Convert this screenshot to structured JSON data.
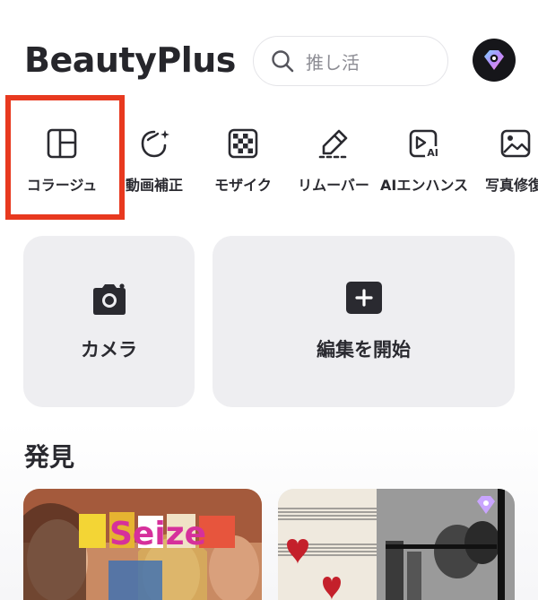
{
  "header": {
    "title": "BeautyPlus",
    "search_placeholder": "推し活"
  },
  "tools": [
    {
      "label": "コラージュ",
      "icon": "collage-icon"
    },
    {
      "label": "動画補正",
      "icon": "video-retouch-icon"
    },
    {
      "label": "モザイク",
      "icon": "mosaic-icon"
    },
    {
      "label": "リムーバー",
      "icon": "remover-icon"
    },
    {
      "label": "AIエンハンス",
      "icon": "ai-enhance-icon"
    },
    {
      "label": "写真修復",
      "icon": "photo-restore-icon"
    }
  ],
  "cards": {
    "camera": {
      "label": "カメラ",
      "icon": "camera-icon"
    },
    "edit": {
      "label": "編集を開始",
      "icon": "plus-icon"
    }
  },
  "discover": {
    "title": "発見",
    "thumb1_text": "Seize"
  },
  "colors": {
    "highlight": "#e8391f",
    "card_bg": "#eeeef1",
    "text": "#2a2a30"
  }
}
